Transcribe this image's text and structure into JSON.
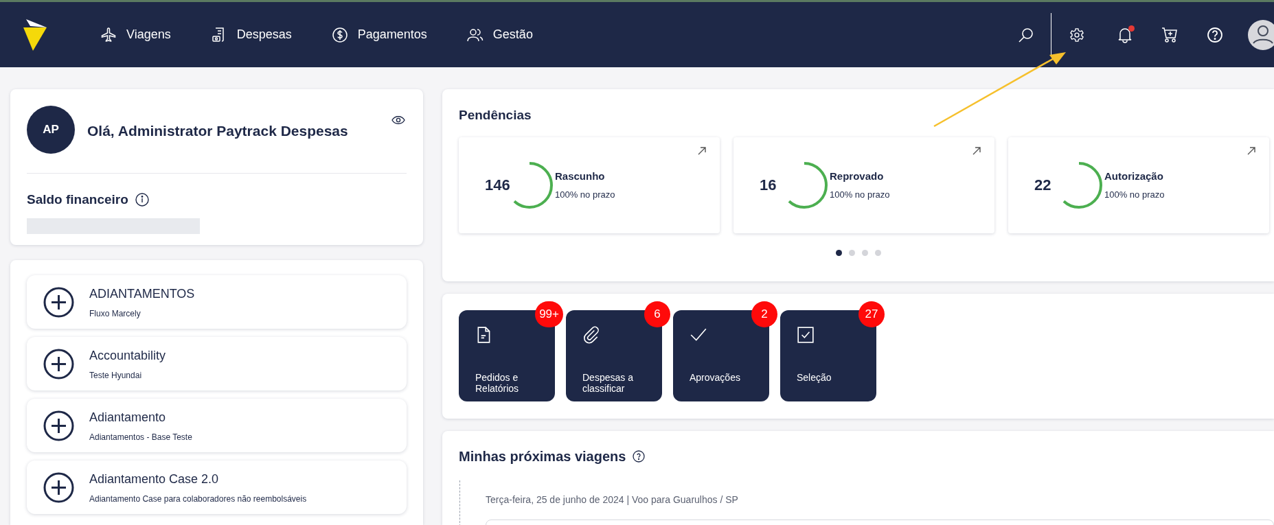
{
  "nav": {
    "items": [
      {
        "kind": "plane",
        "label": "Viagens"
      },
      {
        "kind": "receipt",
        "label": "Despesas"
      },
      {
        "kind": "dollar",
        "label": "Pagamentos"
      },
      {
        "kind": "people",
        "label": "Gestão"
      }
    ],
    "has_notification": true
  },
  "profile": {
    "initials": "AP",
    "greeting": "Olá, Administrator Paytrack Despesas",
    "balance_title": "Saldo financeiro"
  },
  "requests": [
    {
      "title": "ADIANTAMENTOS",
      "subtitle": "Fluxo Marcely"
    },
    {
      "title": "Accountability",
      "subtitle": "Teste Hyundai"
    },
    {
      "title": "Adiantamento",
      "subtitle": "Adiantamentos - Base Teste"
    },
    {
      "title": "Adiantamento Case 2.0",
      "subtitle": "Adiantamento Case para colaboradores não reembolsáveis"
    }
  ],
  "pending": {
    "title": "Pendências",
    "cards": [
      {
        "count": "146",
        "label": "Rascunho",
        "note": "100% no prazo",
        "level": 0.62
      },
      {
        "count": "16",
        "label": "Reprovado",
        "note": "100% no prazo",
        "level": 0.62
      },
      {
        "count": "22",
        "label": "Autorização",
        "note": "100% no prazo",
        "level": 0.62
      }
    ],
    "dots": [
      {
        "selected": true
      },
      {
        "selected": false
      },
      {
        "selected": false
      },
      {
        "selected": false
      }
    ]
  },
  "shortcuts": [
    {
      "kind": "document",
      "label": "Pedidos e Relatórios",
      "badge": "99+"
    },
    {
      "kind": "clip",
      "label": "Despesas a classificar",
      "badge": "6"
    },
    {
      "kind": "check",
      "label": "Aprovações",
      "badge": "2"
    },
    {
      "kind": "checkbox",
      "label": "Seleção",
      "badge": "27"
    }
  ],
  "trips": {
    "title": "Minhas próximas viagens",
    "entries": [
      {
        "date": "Terça-feira, 25 de junho de 2024 | Voo para Guarulhos / SP"
      }
    ]
  }
}
